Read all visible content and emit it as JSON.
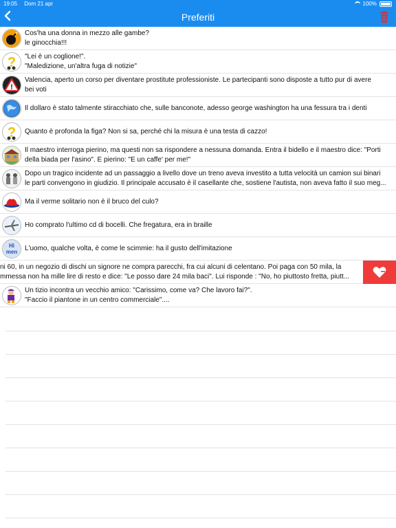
{
  "status_bar": {
    "time": "19:05",
    "date": "Dom 21 apr",
    "battery": "100%"
  },
  "nav": {
    "title": "Preferiti",
    "back_icon": "chevron-left-icon",
    "delete_icon": "trash-icon"
  },
  "colors": {
    "accent": "#1a8cf0",
    "delete_action": "#f03b3b"
  },
  "rows": [
    {
      "icon": "bomb-icon",
      "lines": [
        "Cos'ha una donna in mezzo alle gambe?",
        " le ginocchia!!!"
      ]
    },
    {
      "icon": "question-icon",
      "lines": [
        "\"Lei è un coglione!\".",
        "\"Maledizione, un'altra fuga di notizie\""
      ]
    },
    {
      "icon": "warning-sign-icon",
      "lines": [
        "Valencia, aperto un corso per diventare prostitute professioniste. Le partecipanti sono disposte a tutto pur di avere",
        "bei voti"
      ]
    },
    {
      "icon": "globe-icon",
      "lines": [
        "Il dollaro è stato talmente stiracchiato che, sulle banconote, adesso george washington ha una fessura tra i denti"
      ]
    },
    {
      "icon": "question-icon",
      "lines": [
        "Quanto è profonda la figa? Non si sa, perché chi la misura è una testa di cazzo!"
      ]
    },
    {
      "icon": "school-icon",
      "lines": [
        "Il maestro interroga pierino, ma questi non sa rispondere a nessuna domanda. Entra il bidello e il maestro dice: \"Porti",
        "della biada per l'asino\". E pierino: \"E un caffe' per me!\""
      ]
    },
    {
      "icon": "people-icon",
      "lines": [
        "Dopo un tragico incidente ad un passaggio a livello dove un treno aveva investito a tutta velocità un camion sui binari",
        "le parti convengono in giudizio. Il principale accusato è il casellante che, sostiene l'autista, non aveva fatto il suo meg..."
      ]
    },
    {
      "icon": "hat-icon",
      "lines": [
        "Ma il verme solitario non è il bruco del culo?"
      ]
    },
    {
      "icon": "airplane-icon",
      "lines": [
        "Ho comprato l'ultimo cd di bocelli. Che fregatura, era in braille"
      ]
    },
    {
      "icon": "men-badge-icon",
      "lines": [
        "L'uomo, qualche volta, è come le scimmie: ha il gusto dell'imitazione"
      ]
    },
    {
      "icon": "",
      "swiped": true,
      "action_icon": "heart-minus-icon",
      "lines": [
        "ni 60, in un negozio di dischi un signore ne compra parecchi, fra cui alcuni di celentano. Poi paga con 50 mila, la",
        "mmessa non ha mille lire di resto e dice: \"Le posso dare 24 mila baci\". Lui risponde : \"No, ho piuttosto fretta, piutt..."
      ]
    },
    {
      "icon": "character-icon",
      "lines": [
        "Un tizio incontra un vecchio amico: \"Carissimo, come va? Che lavoro fai?\".",
        "\"Faccio il piantone in un centro commerciale\"...."
      ]
    }
  ]
}
